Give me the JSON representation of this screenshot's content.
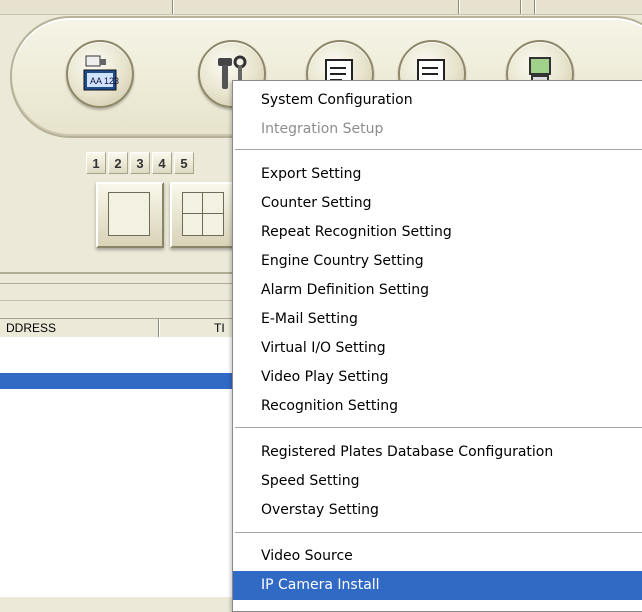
{
  "list": {
    "columns": [
      "DDRESS",
      "TI"
    ]
  },
  "number_buttons": [
    "1",
    "2",
    "3",
    "4",
    "5"
  ],
  "toolbar_icons": [
    "camera-monitor-icon",
    "tools-config-icon",
    "document-edit-icon",
    "document-alert-icon",
    "computer-icon"
  ],
  "context_menu": {
    "group1": [
      {
        "label": "System Configuration",
        "enabled": true
      },
      {
        "label": "Integration Setup",
        "enabled": false
      }
    ],
    "group2": [
      {
        "label": "Export Setting"
      },
      {
        "label": "Counter Setting"
      },
      {
        "label": "Repeat Recognition Setting"
      },
      {
        "label": "Engine Country Setting"
      },
      {
        "label": "Alarm Definition Setting"
      },
      {
        "label": "E-Mail Setting"
      },
      {
        "label": "Virtual I/O Setting"
      },
      {
        "label": "Video Play Setting"
      },
      {
        "label": "Recognition Setting"
      }
    ],
    "group3": [
      {
        "label": "Registered Plates Database Configuration"
      },
      {
        "label": "Speed Setting"
      },
      {
        "label": "Overstay Setting"
      }
    ],
    "group4": [
      {
        "label": "Video Source"
      },
      {
        "label": "IP Camera Install",
        "selected": true
      }
    ]
  },
  "colors": {
    "selection": "#316ac5",
    "window_bg": "#ece9d8",
    "disabled_text": "#8d8d8d"
  }
}
